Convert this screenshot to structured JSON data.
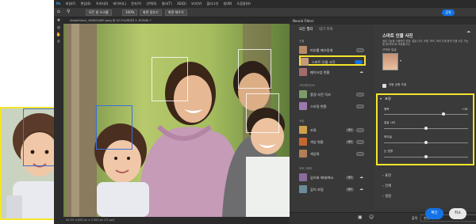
{
  "menu": [
    "파일(F)",
    "편집(E)",
    "이미지(I)",
    "레이어(L)",
    "문자(Y)",
    "선택(S)",
    "필터(T)",
    "3D(D)",
    "보기(V)",
    "플러그인",
    "창(W)",
    "도움말(H)"
  ],
  "options": {
    "zoom_fit": "모든 창 스크롤",
    "zoom_pct": "100%",
    "fit_screen": "화면 맞추기",
    "fill_screen": "화면 채우기"
  },
  "share_label": "공유",
  "doc_tab": "AdobeStock_460825485.jpeg @ 42.5%(레이어 0, RGB/8) *",
  "status_text": "42.5%   3,000 px × 2,000 px (72 ppi)",
  "neural": {
    "panel_title": "Neural Filters",
    "tabs": [
      "모든 필터",
      "대기 목록"
    ],
    "categories": {
      "portrait": "인물",
      "creative": "크리에이티브",
      "color": "색상",
      "photo": "포토그래피"
    },
    "filters": [
      {
        "label": "피부를 매끄럽게",
        "state": "off",
        "thumb": "#b98a6a"
      },
      {
        "label": "스마트 인물 사진",
        "state": "on",
        "thumb": "#c79a7a"
      },
      {
        "label": "메이크업 변환",
        "state": "off",
        "thumb": "#a26c6c"
      },
      {
        "label": "풍경 사진 믹서",
        "state": "off",
        "thumb": "#7e9a6a"
      },
      {
        "label": "스타일 변환",
        "state": "off",
        "thumb": "#9b7ab0"
      },
      {
        "label": "조화",
        "state": "off",
        "thumb": "#d1a04a",
        "badge": "베타"
      },
      {
        "label": "색상 변환",
        "state": "off",
        "thumb": "#c5662f",
        "badge": "베타"
      },
      {
        "label": "색상화",
        "state": "off",
        "thumb": "#b37f5a"
      },
      {
        "label": "깊이와 해대/축소",
        "state": "off",
        "thumb": "#8a6d9a",
        "badge": "베타"
      },
      {
        "label": "깊이 흐림",
        "state": "off",
        "thumb": "#6d8a9a",
        "badge": "베타"
      }
    ]
  },
  "detail": {
    "title": "스마트 인물 사진",
    "desc": "생성 기능을 사용하여 표정, 얼굴 나이, 조명, 포즈, 머리 두께 등의 인물 사진 기능을 창의적으로 조정합니다.",
    "face_label": "선택한 얼굴",
    "auto_balance_label": "자동 균형 조정",
    "expression_section": "표정",
    "sliders": [
      {
        "label": "행복",
        "value_text": "+38",
        "value": 0.69
      },
      {
        "label": "얼굴 나이",
        "value_text": "",
        "value": 0.5
      },
      {
        "label": "머리술",
        "value_text": "",
        "value": 0.5
      },
      {
        "label": "눈 방향",
        "value_text": "",
        "value": 0.5
      }
    ],
    "collapsed": [
      "표현",
      "전체",
      "설정"
    ]
  },
  "output_label": "출력",
  "output_value": "현재 레이어",
  "ok_label": "확인",
  "cancel_label": "취소",
  "colors": {
    "highlight": "#f5e52a",
    "accent": "#1473e6",
    "face_box": "#3d6fd6"
  }
}
